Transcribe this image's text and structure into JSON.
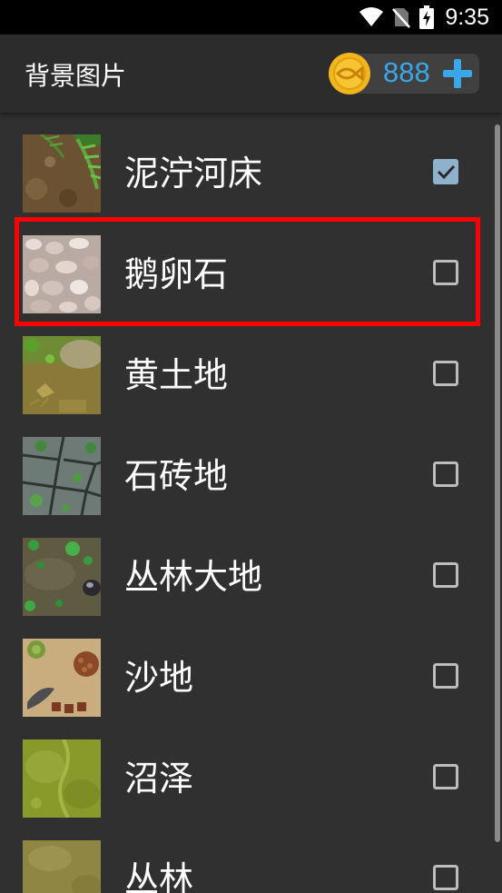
{
  "status_bar": {
    "time": "9:35",
    "icons": [
      "wifi-icon",
      "no-sim-icon",
      "battery-charging-icon"
    ]
  },
  "app_bar": {
    "title": "背景图片",
    "coins": {
      "icon": "fish-coin-icon",
      "count": "888",
      "add_icon": "plus-icon"
    }
  },
  "list": {
    "items": [
      {
        "label": "泥泞河床",
        "checked": true,
        "thumb": "muddy-riverbed"
      },
      {
        "label": "鹅卵石",
        "checked": false,
        "thumb": "pebbles"
      },
      {
        "label": "黄土地",
        "checked": false,
        "thumb": "yellow-earth"
      },
      {
        "label": "石砖地",
        "checked": false,
        "thumb": "stone-brick"
      },
      {
        "label": "丛林大地",
        "checked": false,
        "thumb": "jungle-ground"
      },
      {
        "label": "沙地",
        "checked": false,
        "thumb": "sand"
      },
      {
        "label": "沼泽",
        "checked": false,
        "thumb": "swamp"
      },
      {
        "label": "丛林",
        "checked": false,
        "thumb": "jungle"
      }
    ]
  },
  "colors": {
    "background": "#303030",
    "app_bar": "#2c2c2c",
    "accent_blue": "#3ca7e8",
    "coin_gold": "#f2b51d",
    "checkbox_checked": "#8fb2cc",
    "highlight_red": "#ff0000"
  }
}
